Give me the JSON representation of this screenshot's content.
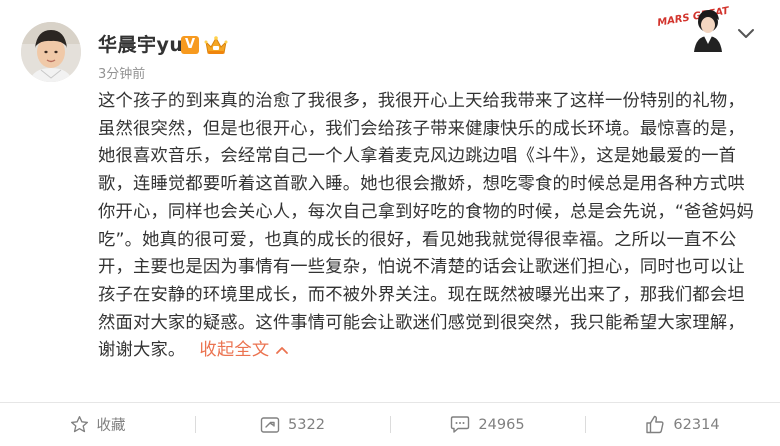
{
  "post": {
    "author": "华晨宇yu",
    "vip_badge": "V",
    "timestamp": "3分钟前",
    "text": "这个孩子的到来真的治愈了我很多，我很开心上天给我带来了这样一份特别的礼物，虽然很突然，但是也很开心，我们会给孩子带来健康快乐的成长环境。最惊喜的是，她很喜欢音乐，会经常自己一个人拿着麦克风边跳边唱《斗牛》，这是她最爱的一首歌，连睡觉都要听着这首歌入睡。她也很会撒娇，想吃零食的时候总是用各种方式哄你开心，同样也会关心人，每次自己拿到好吃的食物的时候，总是会先说，“爸爸妈妈吃”。她真的很可爱，也真的成长的很好，看见她我就觉得很幸福。之所以一直不公开，主要也是因为事情有一些复杂，怕说不清楚的话会让歌迷们担心，同时也可以让孩子在安静的环境里成长，而不被外界关注。现在既然被曝光出来了，那我们都会坦然面对大家的疑惑。这件事情可能会让歌迷们感觉到很突然，我只能希望大家理解，谢谢大家。",
    "collapse_label": "收起全文",
    "link_color": "#eb7350"
  },
  "decoration": {
    "cover_text": "MARS GREAT"
  },
  "actions": {
    "favorite_label": "收藏",
    "repost_count": "5322",
    "comment_count": "24965",
    "like_count": "62314"
  }
}
